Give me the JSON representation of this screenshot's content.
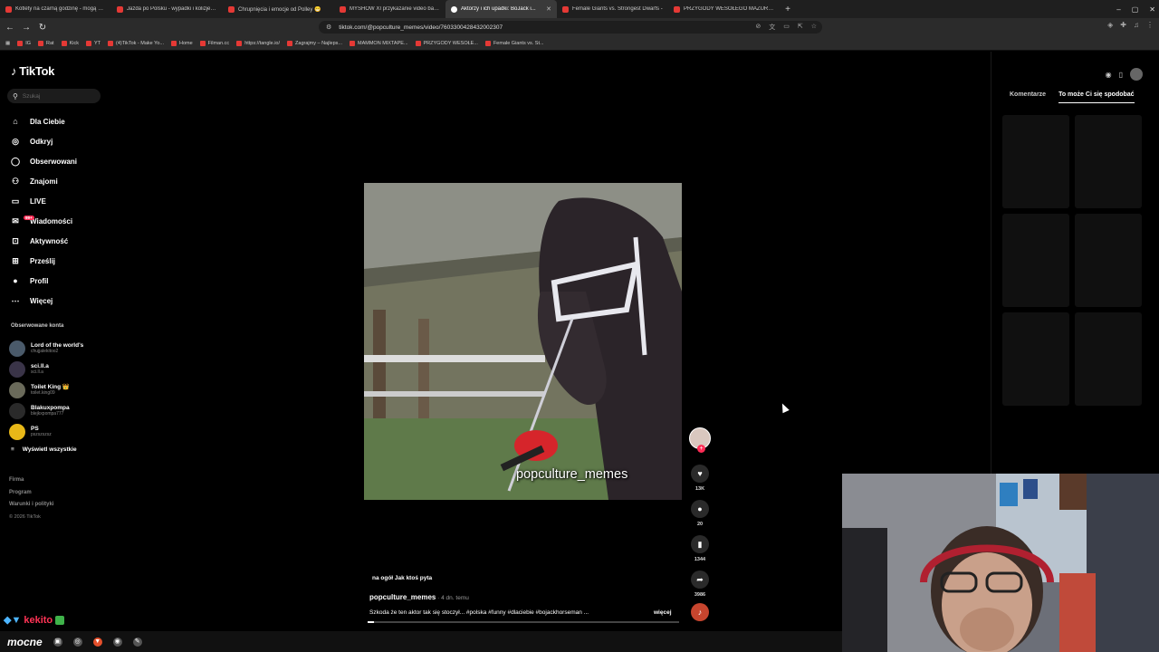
{
  "browser": {
    "tabs": [
      {
        "title": "Kotlety na czarną godzinę - mogą st...",
        "active": false
      },
      {
        "title": "Jazda po Polsku - wypadki i kolizje o...",
        "active": false
      },
      {
        "title": "Chrupnięcia i emocje od Polley 😁",
        "active": false
      },
      {
        "title": "MYSHOW XI przykazanie video back...",
        "active": false
      },
      {
        "title": "Aktorzy i ich upadki: BoJack i...",
        "active": true
      },
      {
        "title": "Female Giants vs. Strongest Dwarfs -",
        "active": false
      },
      {
        "title": "PRZYGODY WESOŁEGO MAZURA we...",
        "active": false
      }
    ],
    "new_tab_icon": "+",
    "url": "tiktok.com/@popculture_memes/video/7603300428432002307",
    "bookmarks": [
      "IG",
      "Rat",
      "Kick",
      "YT",
      "(4)TikTok - Make Yo...",
      "Home",
      "Filman.cc",
      "https://tangle.io/",
      "Zagrajmy – Najleps...",
      "MAMMON MIXTAPE...",
      "PRZYGODY WESOŁE...",
      "Female Giants vs. St..."
    ]
  },
  "tiktok": {
    "logo": "TikTok",
    "search_placeholder": "Szukaj",
    "nav": [
      {
        "label": "Dla Ciebie",
        "icon": "home-icon",
        "glyph": "⌂"
      },
      {
        "label": "Odkryj",
        "icon": "compass-icon",
        "glyph": "◎"
      },
      {
        "label": "Obserwowani",
        "icon": "following-icon",
        "glyph": "◯"
      },
      {
        "label": "Znajomi",
        "icon": "friends-icon",
        "glyph": "⚇"
      },
      {
        "label": "LIVE",
        "icon": "live-icon",
        "glyph": "▭"
      },
      {
        "label": "Wiadomości",
        "icon": "messages-icon",
        "glyph": "✉",
        "badge": "99+"
      },
      {
        "label": "Aktywność",
        "icon": "activity-icon",
        "glyph": "⊡"
      },
      {
        "label": "Prześlij",
        "icon": "upload-icon",
        "glyph": "⊞"
      },
      {
        "label": "Profil",
        "icon": "profile-icon",
        "glyph": "●"
      },
      {
        "label": "Więcej",
        "icon": "more-icon",
        "glyph": "⋯"
      }
    ],
    "followed_heading": "Obserwowane konta",
    "followed": [
      {
        "name": "Lord of the world's",
        "handle": "chujjalekitoo2",
        "color": "#4a5a6a"
      },
      {
        "name": "sci.ll.a",
        "handle": "sci.ll.a",
        "color": "#3a3448"
      },
      {
        "name": "Toilet King 👑",
        "handle": "toilet.king09",
        "color": "#6a6a5a"
      },
      {
        "name": "Blakuxpompa",
        "handle": "blejkxpompa777",
        "color": "#2a2a2a"
      },
      {
        "name": "PS",
        "handle": "pszszszsz",
        "color": "#e8b818"
      }
    ],
    "show_all": "Wyświetl wszystkie",
    "footer": [
      "Firma",
      "Program",
      "Warunki i polityki"
    ],
    "copyright": "© 2026 TikTok",
    "video": {
      "watermark": "popculture_memes",
      "progress": 0.02
    },
    "actions": [
      {
        "name": "like-icon",
        "glyph": "♥",
        "count": "13K"
      },
      {
        "name": "comment-icon",
        "glyph": "●",
        "count": "20"
      },
      {
        "name": "bookmark-icon",
        "glyph": "▮",
        "count": "1344"
      },
      {
        "name": "share-icon",
        "glyph": "➦",
        "count": "3986"
      }
    ],
    "caption": {
      "title": "na ogół Jak ktoś pyta",
      "author": "popculture_memes",
      "age": " · 4 dn. temu",
      "description": "Szkoda że ten aktor tak się stoczył... #polska #funny #dlaciebie #bojackhorseman ...",
      "more": "więcej"
    },
    "right_panel": {
      "tabs": [
        "Komentarze",
        "To może Ci się spodobać"
      ],
      "active_tab": 1
    }
  },
  "overlay": {
    "stream_name": "kekito",
    "taskbar_label": "mocne"
  }
}
